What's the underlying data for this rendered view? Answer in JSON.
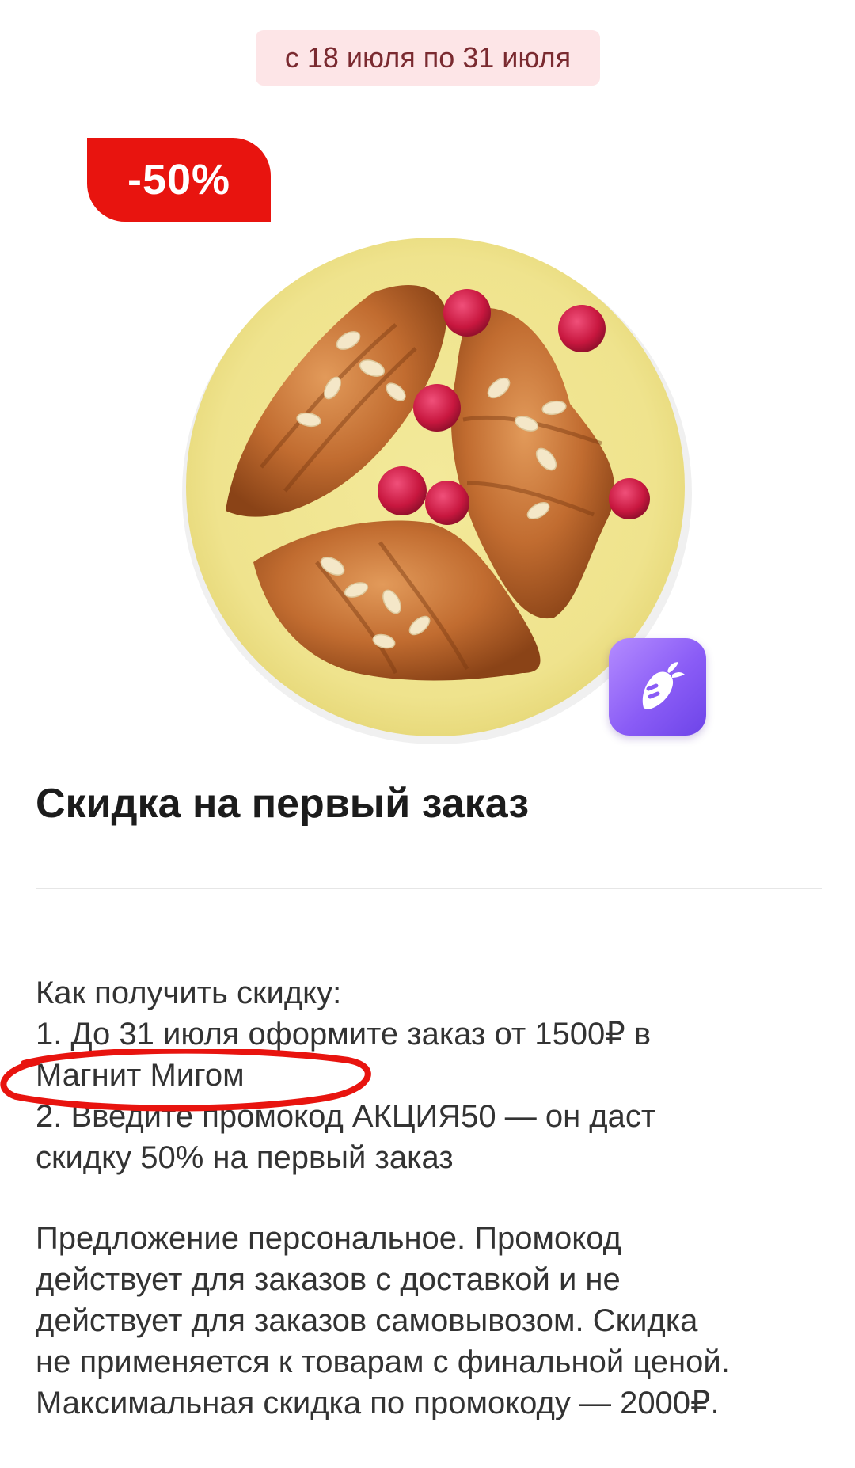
{
  "promo": {
    "period": "с 18 июля по 31 июля",
    "discount": "-50%",
    "title": "Скидка на первый заказ"
  },
  "how_to": [
    "Как получить скидку:",
    "1. До 31 июля оформите заказ от 1500₽ в",
    "Магнит Мигом",
    "2. Введите промокод АКЦИЯ50 — он даст",
    "скидку 50% на первый заказ"
  ],
  "terms": [
    "Предложение персональное. Промокод",
    "действует для заказов с доставкой и не",
    "действует для заказов самовывозом. Скидка",
    "не применяется к товарам с финальной ценой.",
    "Максимальная скидка по промокоду — 2000₽."
  ],
  "colors": {
    "discount_badge": "#e8140f",
    "date_badge_bg": "#fde5e7",
    "app_icon": "#8a5cf6",
    "highlight_ellipse": "#e8140f"
  },
  "icons": {
    "app_icon": "carrot-icon"
  }
}
